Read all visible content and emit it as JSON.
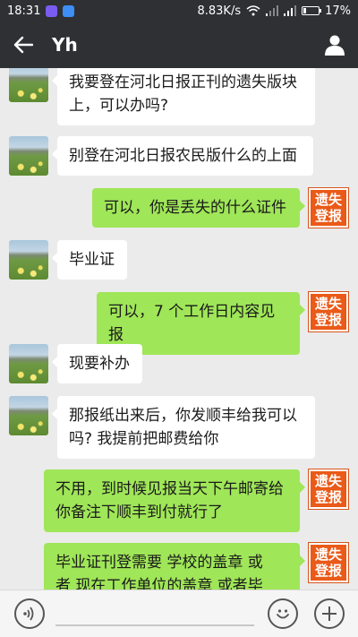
{
  "status_bar": {
    "time": "18:31",
    "network_speed": "8.83K/s",
    "battery": "17%"
  },
  "header": {
    "title": "Yh"
  },
  "messages": [
    {
      "side": "in",
      "lines": [
        "我要登在河北日报正刊的遗失版块",
        "上，可以办吗?"
      ]
    },
    {
      "side": "in",
      "lines": [
        "别登在河北日报农民版什么的上面"
      ]
    },
    {
      "side": "out",
      "lines": [
        "可以，你是丢失的什么证件"
      ]
    },
    {
      "side": "in",
      "lines": [
        "毕业证"
      ]
    },
    {
      "side": "out",
      "lines": [
        "可以，7 个工作日内容见报"
      ]
    },
    {
      "side": "in",
      "lines": [
        "现要补办"
      ]
    },
    {
      "side": "in",
      "lines": [
        "那报纸出来后，你发顺丰给我可以",
        "吗? 我提前把邮费给你"
      ]
    },
    {
      "side": "out",
      "lines": [
        "不用，到时候见报当天下午邮寄给",
        "你备注下顺丰到付就行了"
      ]
    },
    {
      "side": "out",
      "lines": [
        "毕业证刊登需要  学校的盖章   或",
        "者  现在工作单位的盖章   或者毕"
      ]
    }
  ],
  "badge": {
    "line1": "遗失",
    "line2": "登报"
  },
  "colors": {
    "header_bg": "#2e3034",
    "chat_bg": "#ebebeb",
    "outgoing_bubble": "#9fe658",
    "badge": "#ea5a18"
  },
  "icons": {
    "back": "arrow-left-icon",
    "profile": "person-icon",
    "voice": "voice-icon",
    "emoji": "emoji-icon",
    "plus": "plus-icon"
  }
}
